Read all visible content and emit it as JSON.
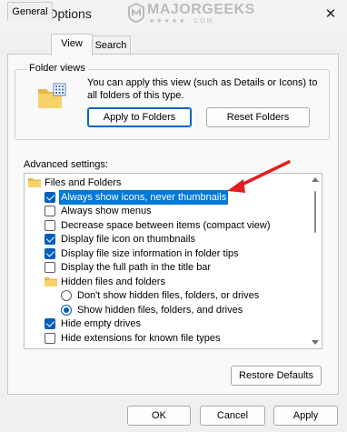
{
  "window": {
    "title": "Folder Options"
  },
  "watermark": {
    "text": "MAJORGEEKS",
    "stars": "★★★★★ .COM"
  },
  "tabs": [
    {
      "label": "General"
    },
    {
      "label": "View"
    },
    {
      "label": "Search"
    }
  ],
  "folder_views": {
    "label": "Folder views",
    "description": "You can apply this view (such as Details or Icons) to all folders of this type.",
    "apply_button": "Apply to Folders",
    "reset_button": "Reset Folders"
  },
  "advanced": {
    "label": "Advanced settings:",
    "items": [
      {
        "type": "folder",
        "label": "Files and Folders",
        "indent": 0
      },
      {
        "type": "checkbox",
        "checked": true,
        "label": "Always show icons, never thumbnails",
        "selected": true,
        "indent": 1
      },
      {
        "type": "checkbox",
        "checked": false,
        "label": "Always show menus",
        "indent": 1
      },
      {
        "type": "checkbox",
        "checked": false,
        "label": "Decrease space between items (compact view)",
        "indent": 1
      },
      {
        "type": "checkbox",
        "checked": true,
        "label": "Display file icon on thumbnails",
        "indent": 1
      },
      {
        "type": "checkbox",
        "checked": true,
        "label": "Display file size information in folder tips",
        "indent": 1
      },
      {
        "type": "checkbox",
        "checked": false,
        "label": "Display the full path in the title bar",
        "indent": 1
      },
      {
        "type": "folder",
        "label": "Hidden files and folders",
        "indent": 1
      },
      {
        "type": "radio",
        "checked": false,
        "label": "Don't show hidden files, folders, or drives",
        "indent": 2
      },
      {
        "type": "radio",
        "checked": true,
        "label": "Show hidden files, folders, and drives",
        "indent": 2
      },
      {
        "type": "checkbox",
        "checked": true,
        "label": "Hide empty drives",
        "indent": 1
      },
      {
        "type": "checkbox",
        "checked": false,
        "label": "Hide extensions for known file types",
        "indent": 1
      }
    ]
  },
  "restore_defaults": "Restore Defaults",
  "footer": {
    "ok": "OK",
    "cancel": "Cancel",
    "apply": "Apply"
  },
  "colors": {
    "accent": "#005fb8",
    "selection": "#0078d7",
    "annotation_arrow": "#e02020"
  }
}
